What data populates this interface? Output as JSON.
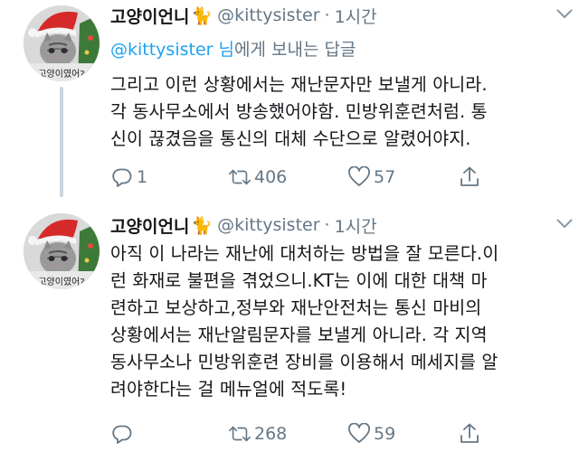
{
  "colors": {
    "accent": "#1da1f2",
    "muted": "#657786",
    "text": "#14171a",
    "thread_line": "#ccd6dd"
  },
  "tweets": [
    {
      "display_name": "고양이언니",
      "name_emoji": "🐈",
      "handle": "@kittysister",
      "separator": "·",
      "time": "1시간",
      "reply_to": {
        "mention": "@kittysister",
        "suffix_highlight": "님",
        "suffix_text": "에게 보내는 답글"
      },
      "body_lines": [
        "그리고 이런 상황에서는 재난문자만 보낼게 아니라.",
        "각 동사무소에서 방송했어야함. 민방위훈련처럼. 통",
        "신이 끊겼음을 통신의 대체 수단으로 알렸어야지."
      ],
      "replies": "1",
      "retweets": "406",
      "likes": "57",
      "icons": {
        "reply": "reply-icon",
        "retweet": "retweet-icon",
        "like": "heart-icon",
        "share": "share-icon",
        "caret": "chevron-down-icon"
      }
    },
    {
      "display_name": "고양이언니",
      "name_emoji": "🐈",
      "handle": "@kittysister",
      "separator": "·",
      "time": "1시간",
      "body_lines": [
        "아직 이 나라는 재난에 대처하는 방법을 잘 모른다.이",
        "런 화재로 불편을 겪었으니.KT는 이에 대한 대책 마",
        "련하고 보상하고,정부와 재난안전처는 통신 마비의",
        "상황에서는 재난알림문자를 보낼게 아니라. 각 지역",
        "동사무소나 민방위훈련 장비를 이용해서 메세지를 알",
        "려야한다는 걸 메뉴얼에 적도록!"
      ],
      "retweets": "268",
      "likes": "59",
      "icons": {
        "reply": "reply-icon",
        "retweet": "retweet-icon",
        "like": "heart-icon",
        "share": "share-icon",
        "caret": "chevron-down-icon"
      }
    }
  ],
  "avatar": {
    "caption": "고양이였어?"
  }
}
